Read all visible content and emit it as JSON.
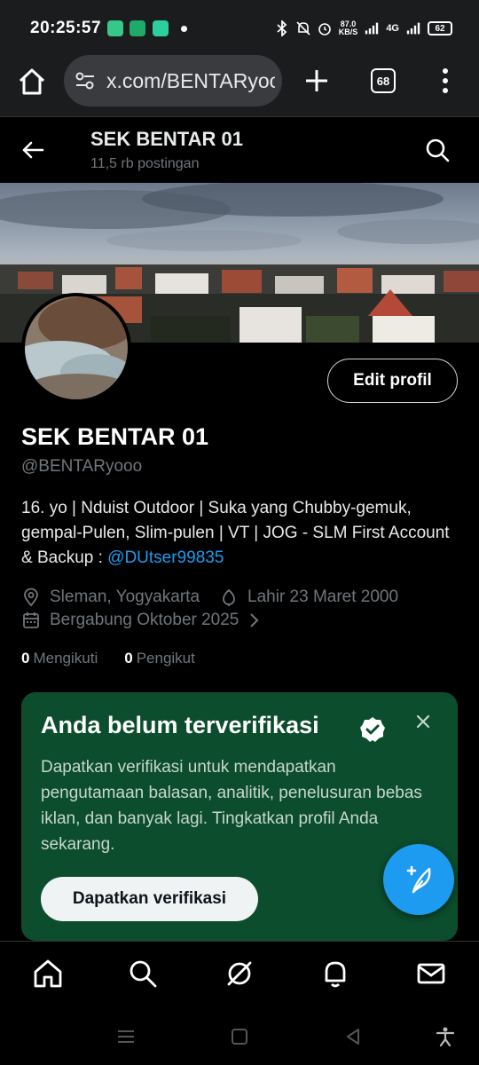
{
  "status_bar": {
    "time": "20:25:57",
    "net_speed_value": "87.0",
    "net_speed_unit": "KB/S",
    "network": "4G",
    "battery": "62"
  },
  "browser": {
    "url": "x.com/BENTARyooo",
    "tab_count": "68"
  },
  "profile_header": {
    "title": "SEK BENTAR 01",
    "post_count": "11,5 rb postingan"
  },
  "profile": {
    "edit_button": "Edit profil",
    "display_name": "SEK BENTAR 01",
    "handle": "@BENTARyooo",
    "bio_text": "16. yo | Nduist Outdoor | Suka yang Chubby-gemuk, gempal-Pulen, Slim-pulen | VT | JOG - SLM First Account & Backup : ",
    "bio_link": "@DUtser99835",
    "location": "Sleman, Yogyakarta",
    "birthday": "Lahir 23 Maret 2000",
    "joined": "Bergabung Oktober 2025",
    "following_count": "0",
    "following_label": "Mengikuti",
    "followers_count": "0",
    "followers_label": "Pengikut"
  },
  "verification_card": {
    "title": "Anda belum terverifikasi",
    "description": "Dapatkan verifikasi untuk mendapatkan pengutamaan balasan, analitik, penelusuran bebas iklan, dan banyak lagi. Tingkatkan profil Anda sekarang.",
    "button": "Dapatkan verifikasi",
    "background_color": "#0b4d2c"
  },
  "bottom_nav": {
    "items": [
      "home-icon",
      "search-icon",
      "grok-icon",
      "notifications-icon",
      "messages-icon"
    ]
  },
  "colors": {
    "accent": "#1d9bf0",
    "muted_text": "#71767b",
    "background": "#000000"
  }
}
